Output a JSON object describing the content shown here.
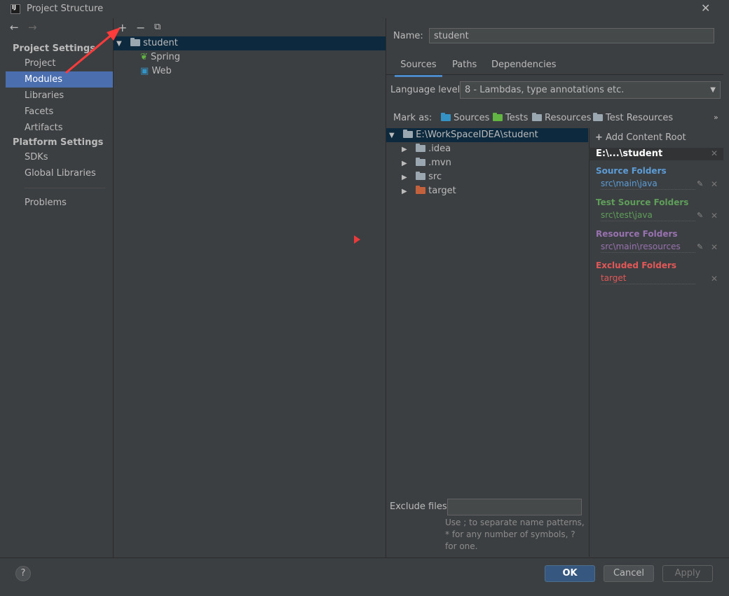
{
  "window": {
    "title": "Project Structure"
  },
  "sidebar": {
    "sections": [
      {
        "title": "Project Settings",
        "items": [
          "Project",
          "Modules",
          "Libraries",
          "Facets",
          "Artifacts"
        ]
      },
      {
        "title": "Platform Settings",
        "items": [
          "SDKs",
          "Global Libraries"
        ]
      }
    ],
    "problems": "Problems",
    "selected": "Modules"
  },
  "toolbar": {
    "add_icon": "plus-icon",
    "remove_icon": "minus-icon",
    "copy_icon": "copy-icon"
  },
  "module_tree": {
    "root": "student",
    "children": [
      "Spring",
      "Web"
    ]
  },
  "module": {
    "name_label": "Name:",
    "name_value": "student",
    "tabs": [
      "Sources",
      "Paths",
      "Dependencies"
    ],
    "active_tab": "Sources",
    "language_level_label": "Language level:",
    "language_level_value": "8 - Lambdas, type annotations etc.",
    "mark_as_label": "Mark as:",
    "mark_as": [
      "Sources",
      "Tests",
      "Resources",
      "Test Resources"
    ]
  },
  "content_tree": {
    "root": "E:\\WorkSpaceIDEA\\student",
    "children": [
      ".idea",
      ".mvn",
      "src",
      "target"
    ]
  },
  "content_root": {
    "add_label": "Add Content Root",
    "header": "E:\\...\\student",
    "source_folders_title": "Source Folders",
    "source_folders": [
      "src\\main\\java"
    ],
    "test_source_folders_title": "Test Source Folders",
    "test_source_folders": [
      "src\\test\\java"
    ],
    "resource_folders_title": "Resource Folders",
    "resource_folders": [
      "src\\main\\resources"
    ],
    "excluded_folders_title": "Excluded Folders",
    "excluded_folders": [
      "target"
    ]
  },
  "exclude_files": {
    "label": "Exclude files:",
    "value": "",
    "hint": "Use ; to separate name patterns, * for any number of symbols, ? for one."
  },
  "buttons": {
    "help": "?",
    "ok": "OK",
    "cancel": "Cancel",
    "apply": "Apply"
  },
  "colors": {
    "selection": "#4b6eaf",
    "source": "#5c9cd7",
    "test_source": "#5f9e5a",
    "resource": "#9872b0",
    "excluded": "#e25757",
    "annotation_red": "#ff3b3b"
  }
}
